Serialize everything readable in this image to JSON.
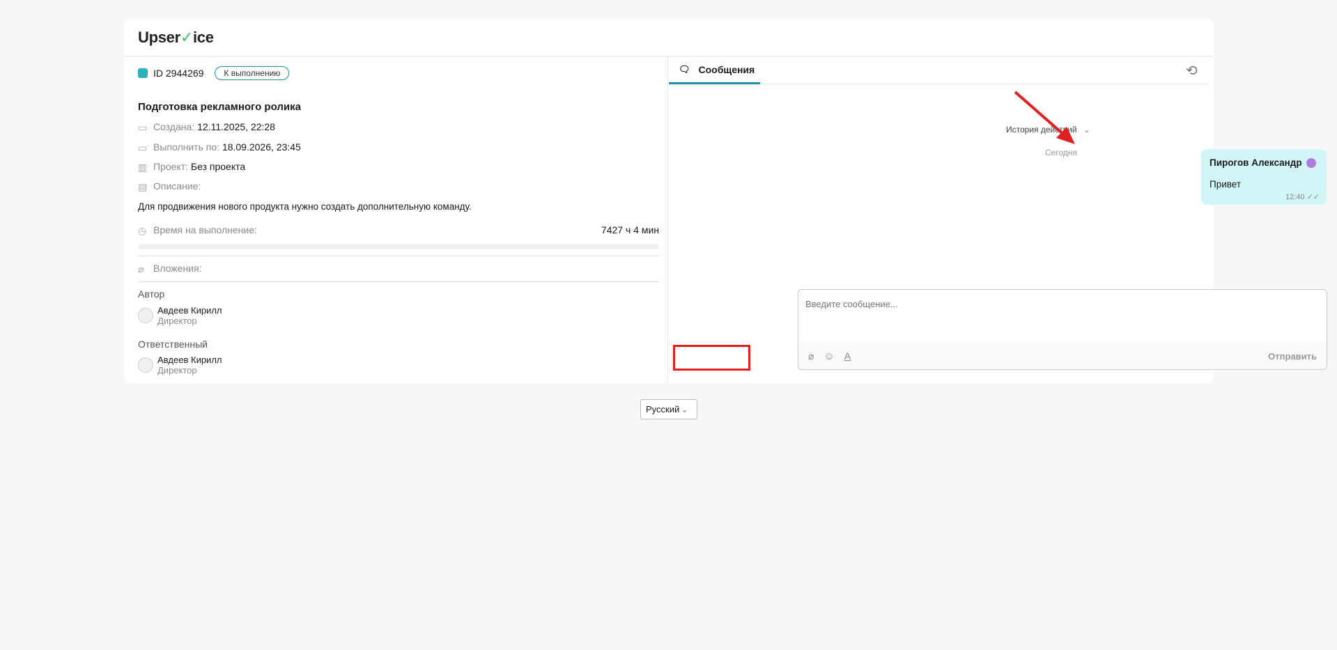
{
  "app": {
    "logo": "Upservice"
  },
  "task": {
    "id": "ID 2944269",
    "status": "К выполнению",
    "title": "Подготовка рекламного ролика",
    "created_label": "Создана:",
    "created_value": "12.11.2025, 22:28",
    "due_label": "Выполнить по:",
    "due_value": "18.09.2026, 23:45",
    "project_label": "Проект:",
    "project_value": "Без проекта",
    "description_label": "Описание:",
    "description": "Для продвижения нового продукта нужно создать дополнительную команду.",
    "time_label": "Время на выполнение:",
    "time_value": "7427 ч 4 мин",
    "time_progress": 0,
    "attachments_label": "Вложения:",
    "author_label": "Автор",
    "author": {
      "name": "Авдеев Кирилл",
      "role": "Директор"
    },
    "assignee_label": "Ответственный",
    "assignee": {
      "name": "Авдеев Кирилл",
      "role": "Директор"
    }
  },
  "messages": {
    "tab": "Сообщения",
    "history_toggle": "История действий",
    "date_divider": "Сегодня",
    "items": [
      {
        "author": "Пирогов Александр",
        "text": "Привет",
        "time": "12:40"
      }
    ],
    "input_placeholder": "Введите сообщение...",
    "send": "Отправить"
  },
  "language": {
    "selected": "Русский"
  },
  "colors": {
    "accent": "#1f8fa8",
    "bubble": "#d2f6f8",
    "logo_check": "#3cbf5a",
    "annotation": "#e02020"
  }
}
